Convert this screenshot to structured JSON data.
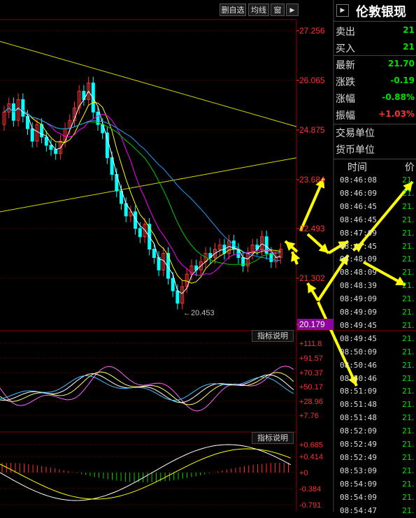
{
  "toolbar": {
    "delete_add_label": "删自选",
    "ma_label": "均线",
    "window_label": "窗",
    "arrow_label": "▶"
  },
  "main_axis": {
    "ticks": [
      "27.256",
      "26.065",
      "24.875",
      "23.684",
      "22.493",
      "21.302",
      "20.179"
    ],
    "low_label": "20.453",
    "current_price": "20.179"
  },
  "indicator1": {
    "button_label": "指标说明",
    "ticks": [
      "+111.8",
      "+91.57",
      "+70.37",
      "+50.17",
      "+28.96",
      "+7.76"
    ]
  },
  "indicator2": {
    "button_label": "指标说明",
    "ticks": [
      "+0.685",
      "+0.414",
      "+0",
      "-0.384",
      "-0.791"
    ]
  },
  "right_panel": {
    "title": "伦敦银现",
    "rows": [
      {
        "label": "卖出",
        "value": "21",
        "color": "#00e000"
      },
      {
        "label": "买入",
        "value": "21",
        "color": "#00e000"
      },
      {
        "label": "最新",
        "value": "21.70",
        "color": "#00e000"
      },
      {
        "label": "涨跌",
        "value": "-0.19",
        "color": "#00e000"
      },
      {
        "label": "涨幅",
        "value": "-0.88%",
        "color": "#00e000"
      },
      {
        "label": "振幅",
        "value": "+1.03%",
        "color": "#ff3030"
      }
    ],
    "trade_unit_label": "交易单位",
    "currency_unit_label": "货币单位",
    "table_headers": {
      "time": "时间",
      "price": "价"
    },
    "ticks": [
      {
        "time": "08:46:08",
        "price": "21."
      },
      {
        "time": "08:46:09",
        "price": "21."
      },
      {
        "time": "08:46:45",
        "price": "21."
      },
      {
        "time": "08:46:45",
        "price": "21."
      },
      {
        "time": "08:47:09",
        "price": "21."
      },
      {
        "time": "08:47:45",
        "price": "21."
      },
      {
        "time": "08:48:09",
        "price": "21."
      },
      {
        "time": "08:48:09",
        "price": "21."
      },
      {
        "time": "08:48:39",
        "price": "21."
      },
      {
        "time": "08:49:09",
        "price": "21."
      },
      {
        "time": "08:49:09",
        "price": "21."
      },
      {
        "time": "08:49:45",
        "price": "21."
      },
      {
        "time": "08:49:45",
        "price": "21."
      },
      {
        "time": "08:50:09",
        "price": "21."
      },
      {
        "time": "08:50:46",
        "price": "21."
      },
      {
        "time": "08:50:46",
        "price": "21."
      },
      {
        "time": "08:51:09",
        "price": "21."
      },
      {
        "time": "08:51:48",
        "price": "21."
      },
      {
        "time": "08:51:48",
        "price": "21."
      },
      {
        "time": "08:52:09",
        "price": "21."
      },
      {
        "time": "08:52:49",
        "price": "21."
      },
      {
        "time": "08:52:49",
        "price": "21."
      },
      {
        "time": "08:53:09",
        "price": "21."
      },
      {
        "time": "08:54:09",
        "price": "21."
      },
      {
        "time": "08:54:09",
        "price": "21."
      },
      {
        "time": "08:54:47",
        "price": "21."
      }
    ]
  },
  "colors": {
    "up": "#ff3030",
    "down": "#00ffff",
    "grid": "#8b0000",
    "arrow": "#ffff00"
  }
}
